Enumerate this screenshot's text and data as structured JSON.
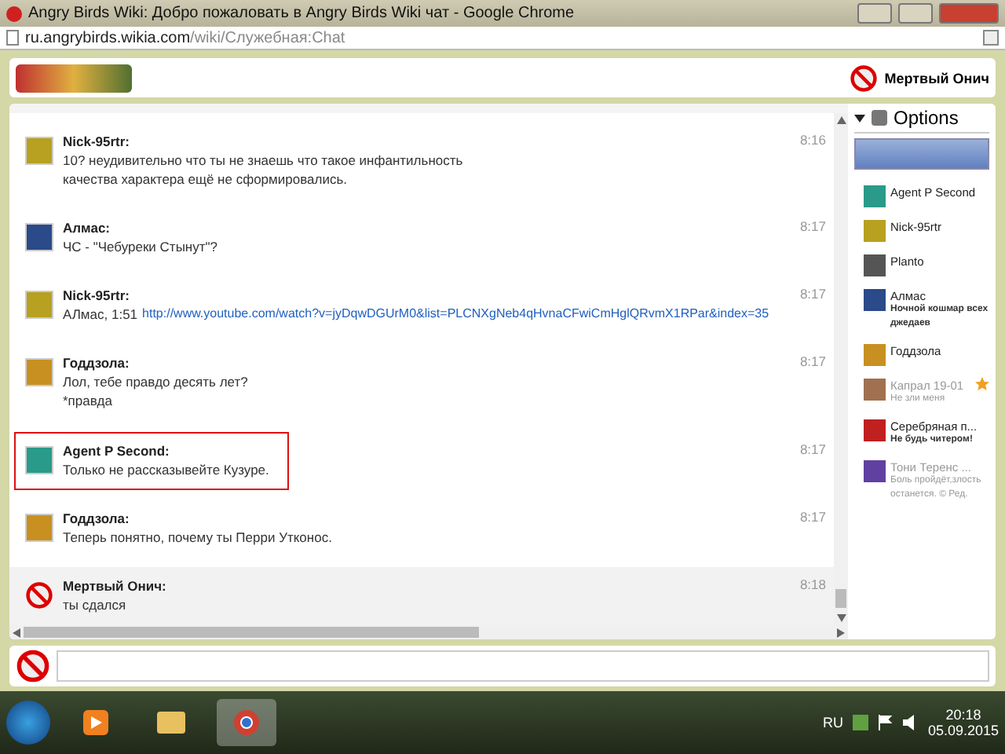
{
  "window": {
    "title": "Angry Birds Wiki: Добро пожаловать в Angry Birds Wiki чат - Google Chrome"
  },
  "address": {
    "host": "ru.angrybirds.wikia.com",
    "path": "/wiki/Служебная:Chat"
  },
  "header": {
    "user": "Мертвый Онич"
  },
  "messages": [
    {
      "author": "Nick-95rtr:",
      "time": "8:16",
      "lines": [
        "10? неудивительно что ты не знаешь что такое инфантильность",
        "качества характера ещё не сформировались."
      ],
      "highlighted": false,
      "own": false
    },
    {
      "author": "Алмас:",
      "time": "8:17",
      "lines": [
        "ЧС - \"Чебуреки Стынут\"?"
      ],
      "highlighted": false,
      "own": false
    },
    {
      "author": "Nick-95rtr:",
      "time": "8:17",
      "lines": [
        "АЛмас, 1:51"
      ],
      "link": "http://www.youtube.com/watch?v=jyDqwDGUrM0&list=PLCNXgNeb4qHvnaCFwiCmHglQRvmX1RPar&index=35",
      "highlighted": false,
      "own": false
    },
    {
      "author": "Годдзола:",
      "time": "8:17",
      "lines": [
        "Лол, тебе правдо десять лет?",
        "*правда"
      ],
      "highlighted": false,
      "own": false
    },
    {
      "author": "Agent P Second:",
      "time": "8:17",
      "lines": [
        "Только не рассказывейте Кузуре."
      ],
      "highlighted": true,
      "own": false
    },
    {
      "author": "Годдзола:",
      "time": "8:17",
      "lines": [
        "Теперь понятно, почему ты Перри Утконос."
      ],
      "highlighted": false,
      "own": false
    },
    {
      "author": "Мертвый Онич:",
      "time": "8:18",
      "lines": [
        "ты сдался"
      ],
      "highlighted": false,
      "own": true
    }
  ],
  "sidebar": {
    "title": "Options",
    "users": [
      {
        "name": "Agent P Second",
        "away": false,
        "starred": false
      },
      {
        "name": "Nick-95rtr",
        "away": false,
        "starred": false
      },
      {
        "name": "Planto",
        "away": false,
        "starred": false
      },
      {
        "name": "Алмас",
        "status": "Ночной кошмар всех джедаев",
        "away": false,
        "starred": false
      },
      {
        "name": "Годдзола",
        "away": false,
        "starred": false
      },
      {
        "name": "Капрал 19-01",
        "status": "Не зли меня",
        "away": true,
        "starred": true
      },
      {
        "name": "Серебряная п...",
        "status": "Не будь читером!",
        "away": false,
        "starred": false
      },
      {
        "name": "Тони Теренс ...",
        "status": "Боль пройдёт,злость останется. © Ред.",
        "away": true,
        "starred": false
      }
    ]
  },
  "tray": {
    "language": "RU",
    "time": "20:18",
    "date": "05.09.2015"
  }
}
